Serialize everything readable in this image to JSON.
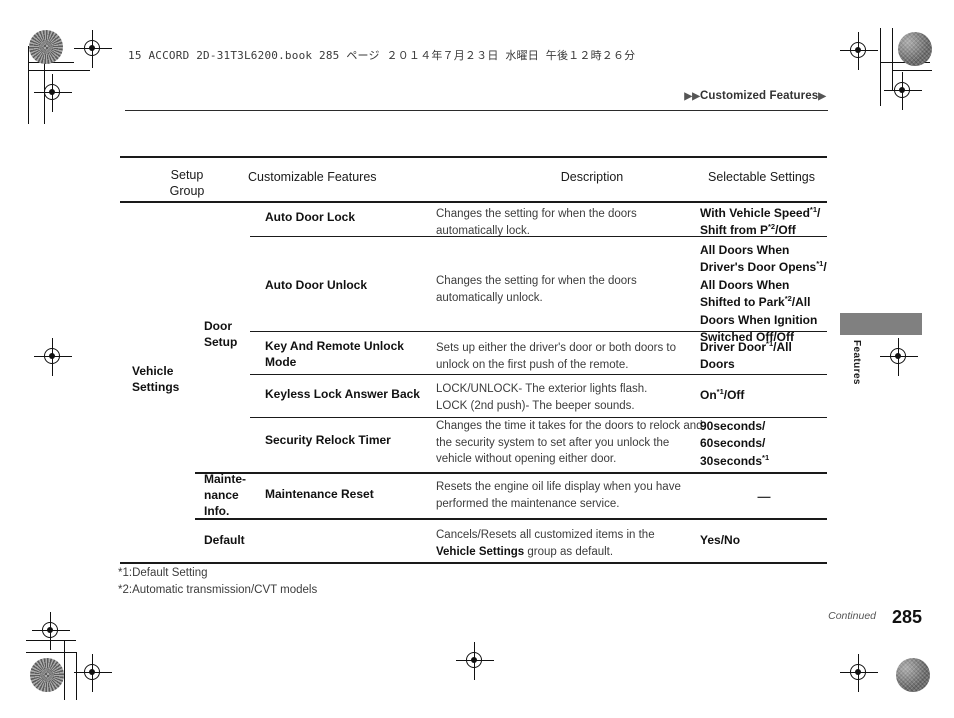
{
  "page": {
    "book_line": "15 ACCORD 2D-31T3L6200.book   285 ページ   ２０１４年７月２３日   水曜日   午後１２時２６分",
    "running_head": "Customized Features",
    "running_head_marker_left": "▶▶",
    "running_head_marker_right": "▶",
    "side_tab_label": "Features",
    "continued_label": "Continued",
    "page_number": "285",
    "tab_color": "#808080"
  },
  "table": {
    "headers": {
      "setup_group": "Setup\nGroup",
      "customizable_features": "Customizable Features",
      "description": "Description",
      "selectable_settings": "Selectable Settings"
    },
    "groups": [
      {
        "group_label": "Vehicle\nSettings",
        "subgroup_label": "Door\nSetup",
        "rows": [
          {
            "feature": "Auto Door Lock",
            "description": "Changes the setting for when the doors automatically lock.",
            "settings_html": "With Vehicle Speed<sup>*1</sup>/<br>Shift from P<sup>*2</sup>/Off"
          },
          {
            "feature": "Auto Door Unlock",
            "description": "Changes the setting for when the doors automatically unlock.",
            "settings_html": "All Doors When<br>Driver's Door Opens<sup>*1</sup>/<br>All Doors When<br>Shifted to Park<sup>*2</sup>/All<br>Doors When Ignition<br>Switched Off/Off"
          },
          {
            "feature": "Key And Remote Unlock Mode",
            "description": "Sets up either the driver's door or both doors to unlock on the first push of the remote.",
            "settings_html": "Driver Door<sup>*1</sup>/All<br>Doors"
          },
          {
            "feature": "Keyless Lock Answer Back",
            "description": "LOCK/UNLOCK- The exterior lights flash.\nLOCK (2nd push)- The beeper sounds.",
            "settings_html": "On<sup>*1</sup>/Off"
          },
          {
            "feature": "Security Relock Timer",
            "description": "Changes the time it takes for the doors to relock and the security system to set after you unlock the vehicle without opening either door.",
            "settings_html": "90seconds/<br>60seconds/<br>30seconds<sup>*1</sup>"
          }
        ]
      },
      {
        "group_label": "Mainte-\nnance\nInfo.",
        "rows": [
          {
            "feature": "Maintenance Reset",
            "description": "Resets the engine oil life display when you have performed the maintenance service.",
            "settings_html": "—"
          }
        ]
      },
      {
        "group_label": "Default",
        "rows": [
          {
            "feature": "",
            "description_html": "Cancels/Resets all customized items in the<br><b>Vehicle Settings</b> group as default.",
            "settings_html": "Yes/No"
          }
        ]
      }
    ]
  },
  "footnotes": [
    "*1:Default Setting",
    "*2:Automatic transmission/CVT models"
  ]
}
